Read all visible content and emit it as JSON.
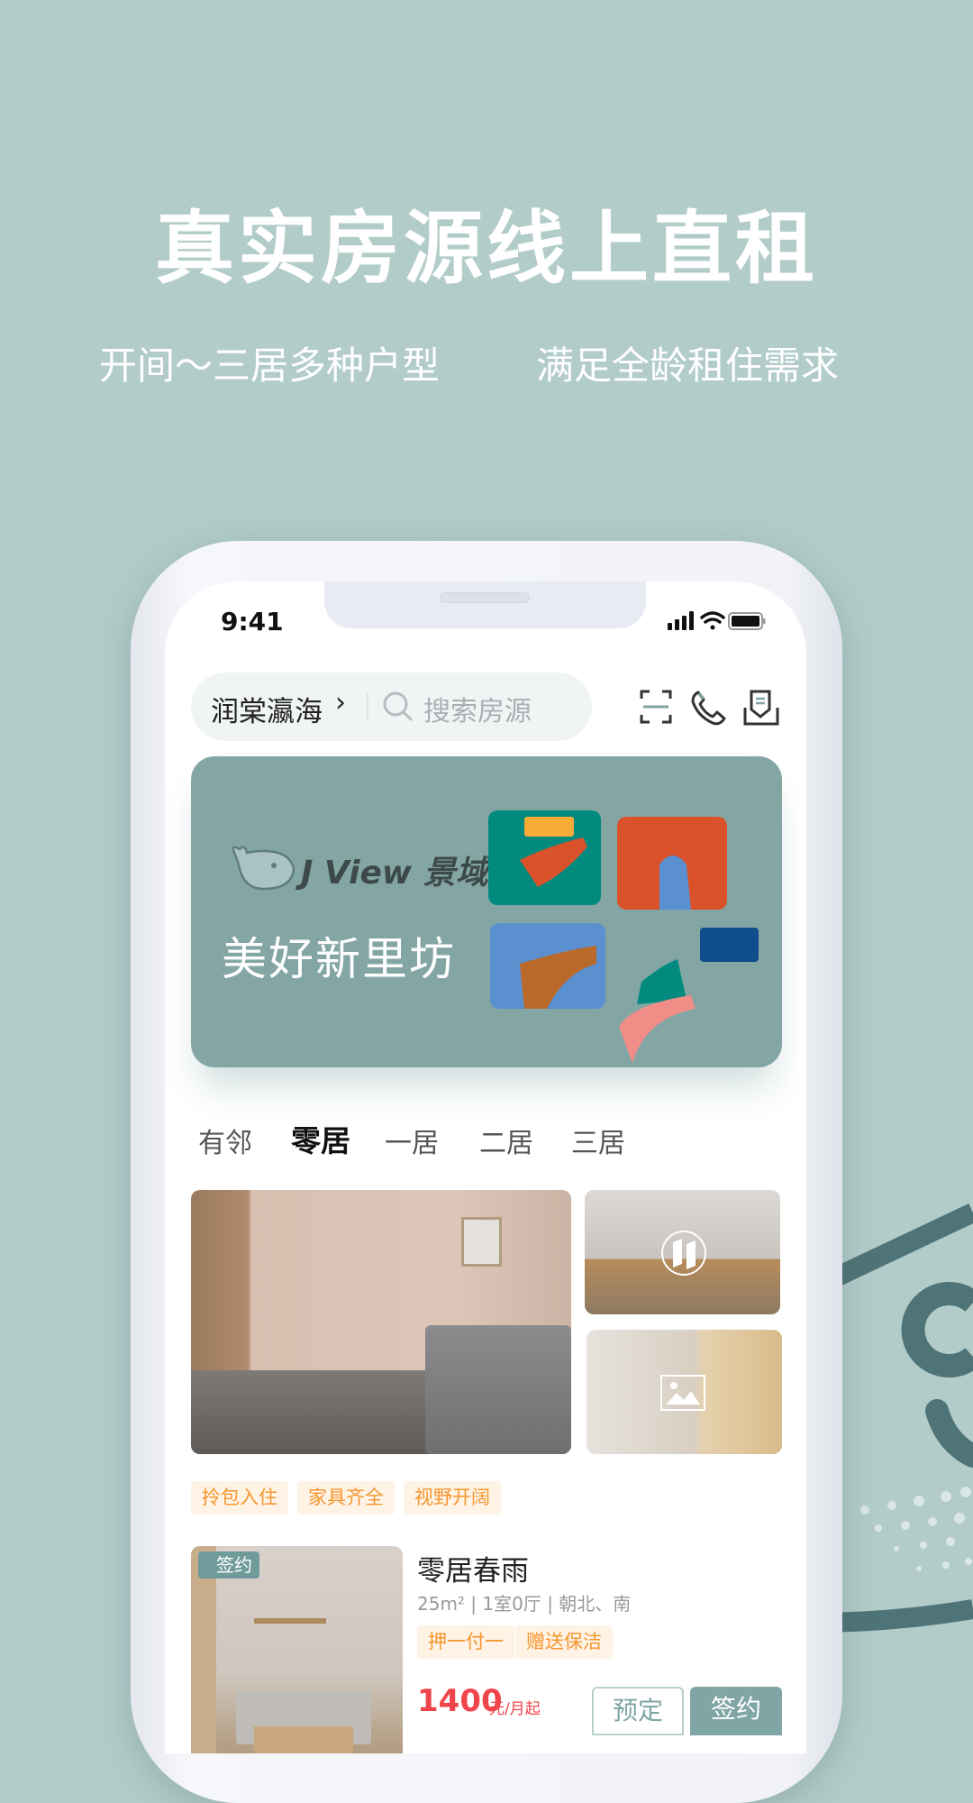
{
  "hero": {
    "title": "真实房源线上直租",
    "subtitle_left": "开间～三居多种户型",
    "subtitle_right": "满足全龄租住需求"
  },
  "colors": {
    "background": "#b2ccca",
    "accent": "#7fa5a4",
    "banner": "#83a6a5",
    "price": "#f0454b",
    "tag_text": "#f5962e",
    "tag_bg": "#fff3e6"
  },
  "status_bar": {
    "time": "9:41",
    "icons": [
      "signal-icon",
      "wifi-icon",
      "battery-icon"
    ]
  },
  "header": {
    "location": "润棠瀛海",
    "chevron": "›",
    "search_placeholder": "搜索房源",
    "icons": [
      "scan-icon",
      "phone-icon",
      "inbox-icon"
    ]
  },
  "banner": {
    "logo": "J View 景域",
    "slogan": "美好新里坊"
  },
  "tabs": [
    {
      "label": "有邻"
    },
    {
      "label": "零居",
      "active": true
    },
    {
      "label": "一居"
    },
    {
      "label": "二居"
    },
    {
      "label": "三居"
    }
  ],
  "gallery": {
    "icons": [
      "vr-icon",
      "image-icon"
    ],
    "tags": [
      "拎包入住",
      "家具齐全",
      "视野开阔"
    ]
  },
  "listing": {
    "badge": "签约",
    "title": "零居春雨",
    "specs": "25m² | 1室0厅 | 朝北、南",
    "tags": [
      "押一付一",
      "赠送保洁"
    ],
    "price": "1400",
    "price_unit": "元/月起",
    "reserve_label": "预定",
    "sign_label": "签约"
  }
}
